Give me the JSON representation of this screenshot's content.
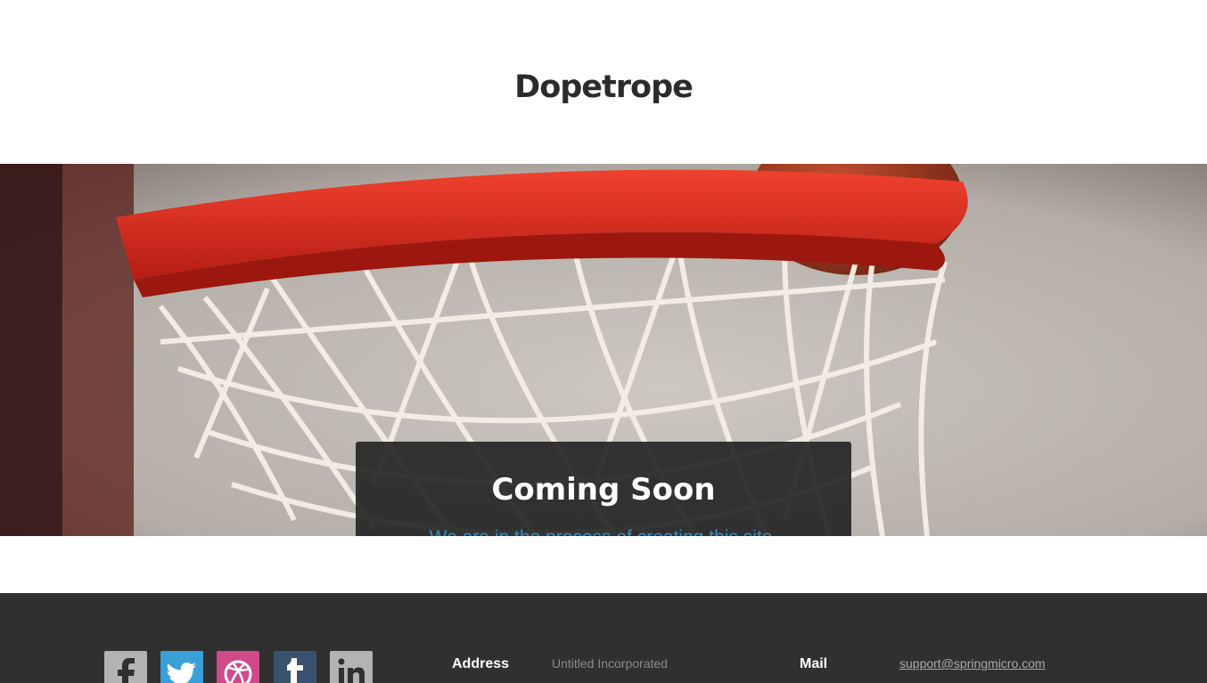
{
  "header": {
    "site_title": "Dopetrope"
  },
  "banner": {
    "heading": "Coming Soon",
    "subtext": "We are in the process of creating this site."
  },
  "footer": {
    "social": [
      {
        "name": "facebook-icon",
        "color": "#b3b3b3"
      },
      {
        "name": "twitter-icon",
        "color": "#3aa0d8"
      },
      {
        "name": "dribbble-icon",
        "color": "#cf4a8a"
      },
      {
        "name": "tumblr-icon",
        "color": "#3b5170"
      },
      {
        "name": "linkedin-icon",
        "color": "#b3b3b3"
      }
    ],
    "address_label": "Address",
    "address_value": "Untitled Incorporated",
    "mail_label": "Mail",
    "mail_value": "support@springmicro.com"
  },
  "colors": {
    "footer_bg": "#303030",
    "accent_blue": "#2e8fc9",
    "hoop_red": "#d62a1c"
  }
}
